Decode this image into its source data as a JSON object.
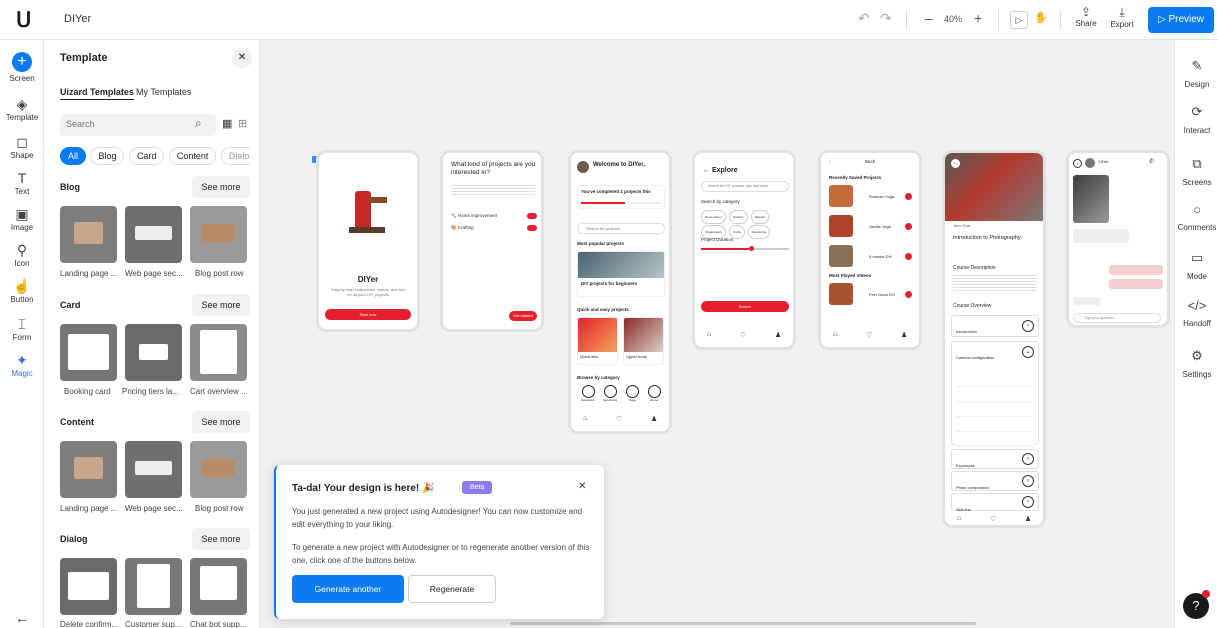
{
  "app": {
    "name": "DIYer"
  },
  "toolbar": {
    "zoom": "40%",
    "share": "Share",
    "export": "Export",
    "preview": "Preview"
  },
  "left_rail": {
    "items": [
      {
        "label": "Screen",
        "icon": "plus-icon"
      },
      {
        "label": "Template",
        "icon": "layers-icon"
      },
      {
        "label": "Shape",
        "icon": "shape-icon"
      },
      {
        "label": "Text",
        "icon": "text-icon"
      },
      {
        "label": "Image",
        "icon": "image-icon"
      },
      {
        "label": "Icon",
        "icon": "icon-icon"
      },
      {
        "label": "Button",
        "icon": "cursor-icon"
      },
      {
        "label": "Form",
        "icon": "form-icon"
      },
      {
        "label": "Magic",
        "icon": "magic-wand-icon"
      }
    ]
  },
  "panel": {
    "title": "Template",
    "tabs": [
      "Uizard Templates",
      "My Templates"
    ],
    "search_placeholder": "Search",
    "filters": [
      "All",
      "Blog",
      "Card",
      "Content",
      "Dialo"
    ],
    "sections": [
      {
        "name": "Blog",
        "see_more": "See more",
        "items": [
          "Landing page ...",
          "Web page sec...",
          "Blog post row"
        ]
      },
      {
        "name": "Card",
        "see_more": "See more",
        "items": [
          "Booking card",
          "Pricing tiers la...",
          "Cart overview ..."
        ]
      },
      {
        "name": "Content",
        "see_more": "See more",
        "items": [
          "Landing page ...",
          "Web page sec...",
          "Blog post row"
        ]
      },
      {
        "name": "Dialog",
        "see_more": "See more",
        "items": [
          "Delete confirm...",
          "Customer sup...",
          "Chat bot supp..."
        ]
      }
    ]
  },
  "right_rail": {
    "items": [
      {
        "label": "Design",
        "icon": "pen-icon"
      },
      {
        "label": "Interact",
        "icon": "interact-icon"
      },
      {
        "label": "Screens",
        "icon": "screens-icon"
      },
      {
        "label": "Comments",
        "icon": "comment-icon"
      },
      {
        "label": "Mode",
        "icon": "mode-icon"
      },
      {
        "label": "Handoff",
        "icon": "code-icon"
      },
      {
        "label": "Settings",
        "icon": "gear-icon"
      }
    ]
  },
  "screens": {
    "s1": {
      "title": "DIYer",
      "sub": "Step-by-step instructions, videos, and tips for all your DIY projects",
      "btn": "Start now"
    },
    "s2": {
      "title": "What kind of projects are you interested in?",
      "opts": [
        "Home improvement",
        "Crafting"
      ],
      "btn": "Get started"
    },
    "s3": {
      "hello": "Welcome to DIYer,",
      "banner": "You've completed 2 projects this",
      "search": "Search for projects",
      "popular": "Most popular projects",
      "card": "DIY projects for beginners",
      "quick": "Quick and easy projects",
      "q1": "Quick abs",
      "q2": "Upper body",
      "browse": "Browse by category",
      "cats": [
        "Education",
        "Gardening",
        "Yoga",
        "Home"
      ]
    },
    "s4": {
      "title": "Explore",
      "search": "Search for DIY projects, tips, and more",
      "bycat": "Search by category",
      "chips": [
        "Home Décor",
        "Outdoor",
        "Repairs",
        "Organization",
        "Crafts",
        "Gardening"
      ],
      "duration": "Project Duration",
      "btn": "Search"
    },
    "s5": {
      "back": "Back",
      "saved": "Recently Saved Projects",
      "items": [
        "Summer Yoga",
        "Gentle Yoga",
        "5-minute DIY"
      ],
      "played": "Most Played Videos",
      "p1": "Feel Good DIY"
    },
    "s6": {
      "author": "John Doe",
      "title": "Introduction to Photography",
      "desc_h": "Course Description",
      "overview": "Course Overview",
      "lessons": [
        "Introduction",
        "Camera configuration",
        "Exposures",
        "Photo composition",
        "Skill test"
      ]
    },
    "s7": {
      "name": "DIYer",
      "msg": "Type your question..."
    }
  },
  "dialog": {
    "title": "Ta-da! Your design is here!",
    "badge": "Beta",
    "p1": "You just generated a new project using Autodesigner! You can now customize and edit everything to your liking.",
    "p2": "To generate a new project with Autodesigner or to regenerate another version of this one, click one of the buttons below.",
    "primary": "Generate another",
    "secondary": "Regenerate"
  },
  "help": "?"
}
